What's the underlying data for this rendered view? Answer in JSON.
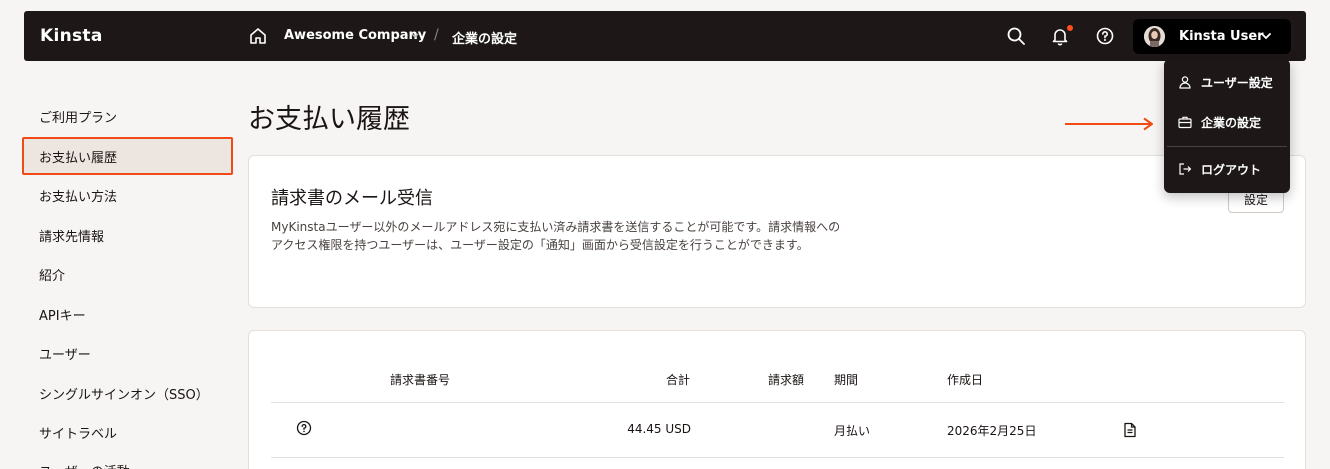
{
  "topbar": {
    "logo": "Kinsta",
    "company": "Awesome Company",
    "breadcrumb_sep": "/",
    "breadcrumb": "企業の設定",
    "user_name": "Kinsta User"
  },
  "dropdown": {
    "items": [
      {
        "label": "ユーザー設定",
        "icon": "user-icon"
      },
      {
        "label": "企業の設定",
        "icon": "briefcase-icon"
      },
      {
        "label": "ログアウト",
        "icon": "logout-icon"
      }
    ]
  },
  "sidebar": {
    "items": [
      {
        "label": "ご利用プラン"
      },
      {
        "label": "お支払い履歴",
        "active": true
      },
      {
        "label": "お支払い方法"
      },
      {
        "label": "請求先情報"
      },
      {
        "label": "紹介"
      },
      {
        "label": "APIキー"
      },
      {
        "label": "ユーザー"
      },
      {
        "label": "シングルサインオン（SSO）"
      },
      {
        "label": "サイトラベル"
      },
      {
        "label": "ユーザーの活動"
      }
    ]
  },
  "main": {
    "title": "お支払い履歴",
    "email_card": {
      "title": "請求書のメール受信",
      "description": "MyKinstaユーザー以外のメールアドレス宛に支払い済み請求書を送信することが可能です。請求情報へのアクセス権限を持つユーザーは、ユーザー設定の「通知」画面から受信設定を行うことができます。",
      "button": "設定"
    },
    "invoices": {
      "columns": [
        "請求書番号",
        "合計",
        "請求額",
        "期間",
        "作成日"
      ],
      "rows": [
        {
          "number": "",
          "total": "44.45 USD",
          "billed": "",
          "period": "月払い",
          "created": "2026年2月25日"
        }
      ]
    }
  },
  "colors": {
    "accent": "#f04a17",
    "topbar_bg": "#1d1817",
    "page_bg": "#f7f5f3"
  }
}
